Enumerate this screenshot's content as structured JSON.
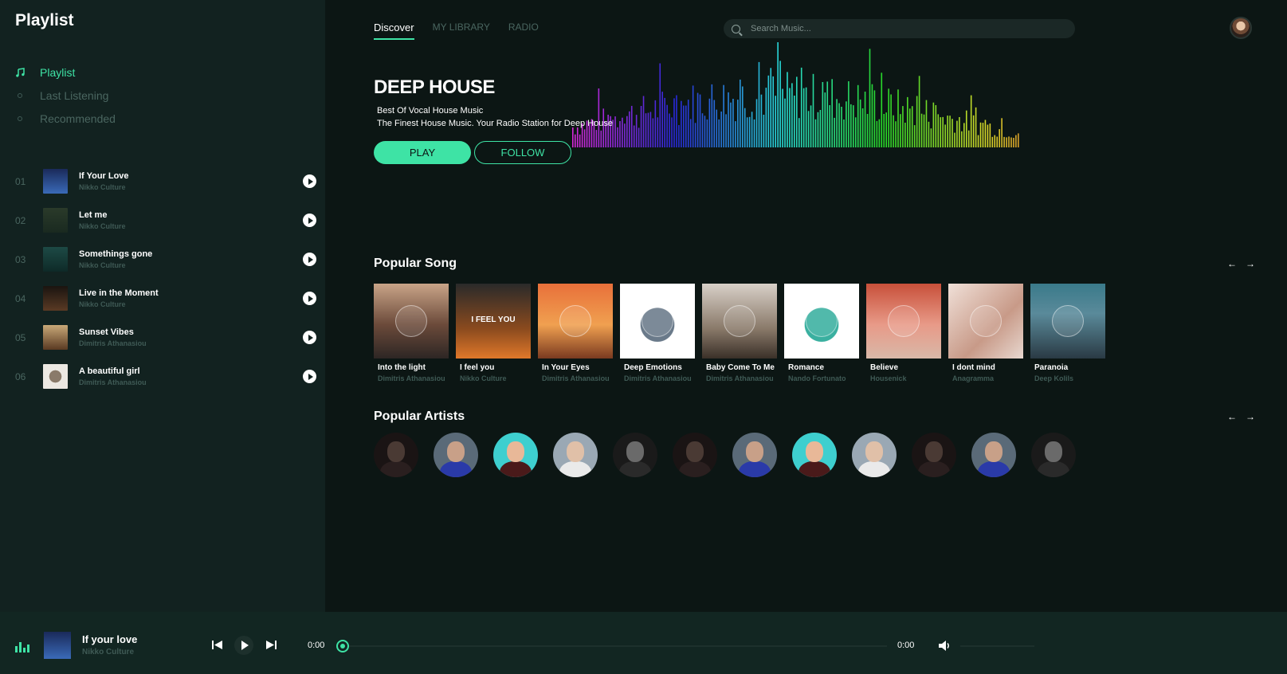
{
  "sidebar": {
    "title": "Playlist",
    "nav": [
      {
        "label": "Playlist",
        "active": true,
        "icon": "music-note-icon"
      },
      {
        "label": "Last Listening",
        "active": false,
        "icon": "dot-icon"
      },
      {
        "label": "Recommended",
        "active": false,
        "icon": "dot-icon"
      }
    ],
    "tracks": [
      {
        "num": "01",
        "title": "If Your Love",
        "artist": "Nikko Culture",
        "color": "#2c4d8f"
      },
      {
        "num": "02",
        "title": "Let me",
        "artist": "Nikko Culture",
        "color": "#1f3a2c"
      },
      {
        "num": "03",
        "title": "Somethings gone",
        "artist": "Nikko Culture",
        "color": "#1d4a45"
      },
      {
        "num": "04",
        "title": "Live in the Moment",
        "artist": "Nikko Culture",
        "color": "#3a2a1e"
      },
      {
        "num": "05",
        "title": "Sunset Vibes",
        "artist": "Dimitris Athanasiou",
        "color": "#8a6a3a"
      },
      {
        "num": "06",
        "title": "A beautiful girl",
        "artist": "Dimitris Athanasiou",
        "color": "#d9d4cc"
      }
    ]
  },
  "header": {
    "tabs": [
      {
        "label": "Discover",
        "active": true
      },
      {
        "label": "MY LIBRARY",
        "active": false
      },
      {
        "label": "RADIO",
        "active": false
      }
    ],
    "search_placeholder": "Search Music..."
  },
  "hero": {
    "title": "DEEP HOUSE",
    "subtitle1": "Best Of Vocal House Music",
    "subtitle2": "The Finest House Music. Your Radio Station for Deep House",
    "play_label": "PLAY",
    "follow_label": "FOLLOW"
  },
  "popular_songs": {
    "title": "Popular Song",
    "items": [
      {
        "title": "Into the light",
        "artist": "Dimitris Athanasiou",
        "bg": "linear-gradient(180deg,#c9a488,#6b4a3a 55%,#2d2624)",
        "cap": ""
      },
      {
        "title": "I feel you",
        "artist": "Nikko Culture",
        "bg": "linear-gradient(180deg,#2a2a2a,#8a4a1e 60%,#e0782a)",
        "cap": "I FEEL YOU"
      },
      {
        "title": "In Your Eyes",
        "artist": "Dimitris Athanasiou",
        "bg": "linear-gradient(180deg,#e8703a,#f0a050 55%,#7a3a20)",
        "cap": ""
      },
      {
        "title": "Deep Emotions",
        "artist": "Dimitris Athanasiou",
        "bg": "radial-gradient(circle at 50% 55%,#6a7a8a 0 30%,#fff 31%)",
        "cap": ""
      },
      {
        "title": "Baby Come To Me",
        "artist": "Dimitris Athanasiou",
        "bg": "linear-gradient(180deg,#d8d0c8,#8a7a6a 60%,#3a3028)",
        "cap": ""
      },
      {
        "title": "Romance",
        "artist": "Nando Fortunato",
        "bg": "radial-gradient(circle at 50% 55%,#3ab0a0 0 30%,#fff 31%)",
        "cap": ""
      },
      {
        "title": "Believe",
        "artist": "Housenick",
        "bg": "linear-gradient(180deg,#c8503a,#e89a88 55%,#d8b8a8)",
        "cap": ""
      },
      {
        "title": "I dont mind",
        "artist": "Anagramma",
        "bg": "linear-gradient(135deg,#f0e0d8,#c89a88 60%,#e8d8d0)",
        "cap": ""
      },
      {
        "title": "Paranoia",
        "artist": "Deep Kolils",
        "bg": "linear-gradient(180deg,#3a7a8a,#5a8a9a 40%,#2a3a44)",
        "cap": ""
      }
    ]
  },
  "popular_artists": {
    "title": "Popular Artists",
    "items": [
      {
        "bg": "#1a1414",
        "head": "#4a3a34",
        "body": "#2a1f1f"
      },
      {
        "bg": "#5a6a78",
        "head": "#c8a088",
        "body": "#2a3aa8"
      },
      {
        "bg": "#3ecfcf",
        "head": "#e8b898",
        "body": "#4a1a1a"
      },
      {
        "bg": "#9aa8b4",
        "head": "#e0c0a8",
        "body": "#eaeaea"
      },
      {
        "bg": "#1a1a1a",
        "head": "#6a6a6a",
        "body": "#2a2a2a"
      },
      {
        "bg": "#1a1414",
        "head": "#4a3a34",
        "body": "#2a1f1f"
      },
      {
        "bg": "#5a6a78",
        "head": "#c8a088",
        "body": "#2a3aa8"
      },
      {
        "bg": "#3ecfcf",
        "head": "#e8b898",
        "body": "#4a1a1a"
      },
      {
        "bg": "#9aa8b4",
        "head": "#e0c0a8",
        "body": "#eaeaea"
      },
      {
        "bg": "#1a1414",
        "head": "#4a3a34",
        "body": "#2a1f1f"
      },
      {
        "bg": "#5a6a78",
        "head": "#c8a088",
        "body": "#2a3aa8"
      },
      {
        "bg": "#1a1a1a",
        "head": "#6a6a6a",
        "body": "#2a2a2a"
      }
    ]
  },
  "player": {
    "title": "If your love",
    "artist": "Nikko Culture",
    "time_current": "0:00",
    "time_total": "0:00",
    "progress": 0
  },
  "colors": {
    "accent": "#3ee3a5",
    "background": "#0c1614",
    "sidebar": "#122220"
  }
}
